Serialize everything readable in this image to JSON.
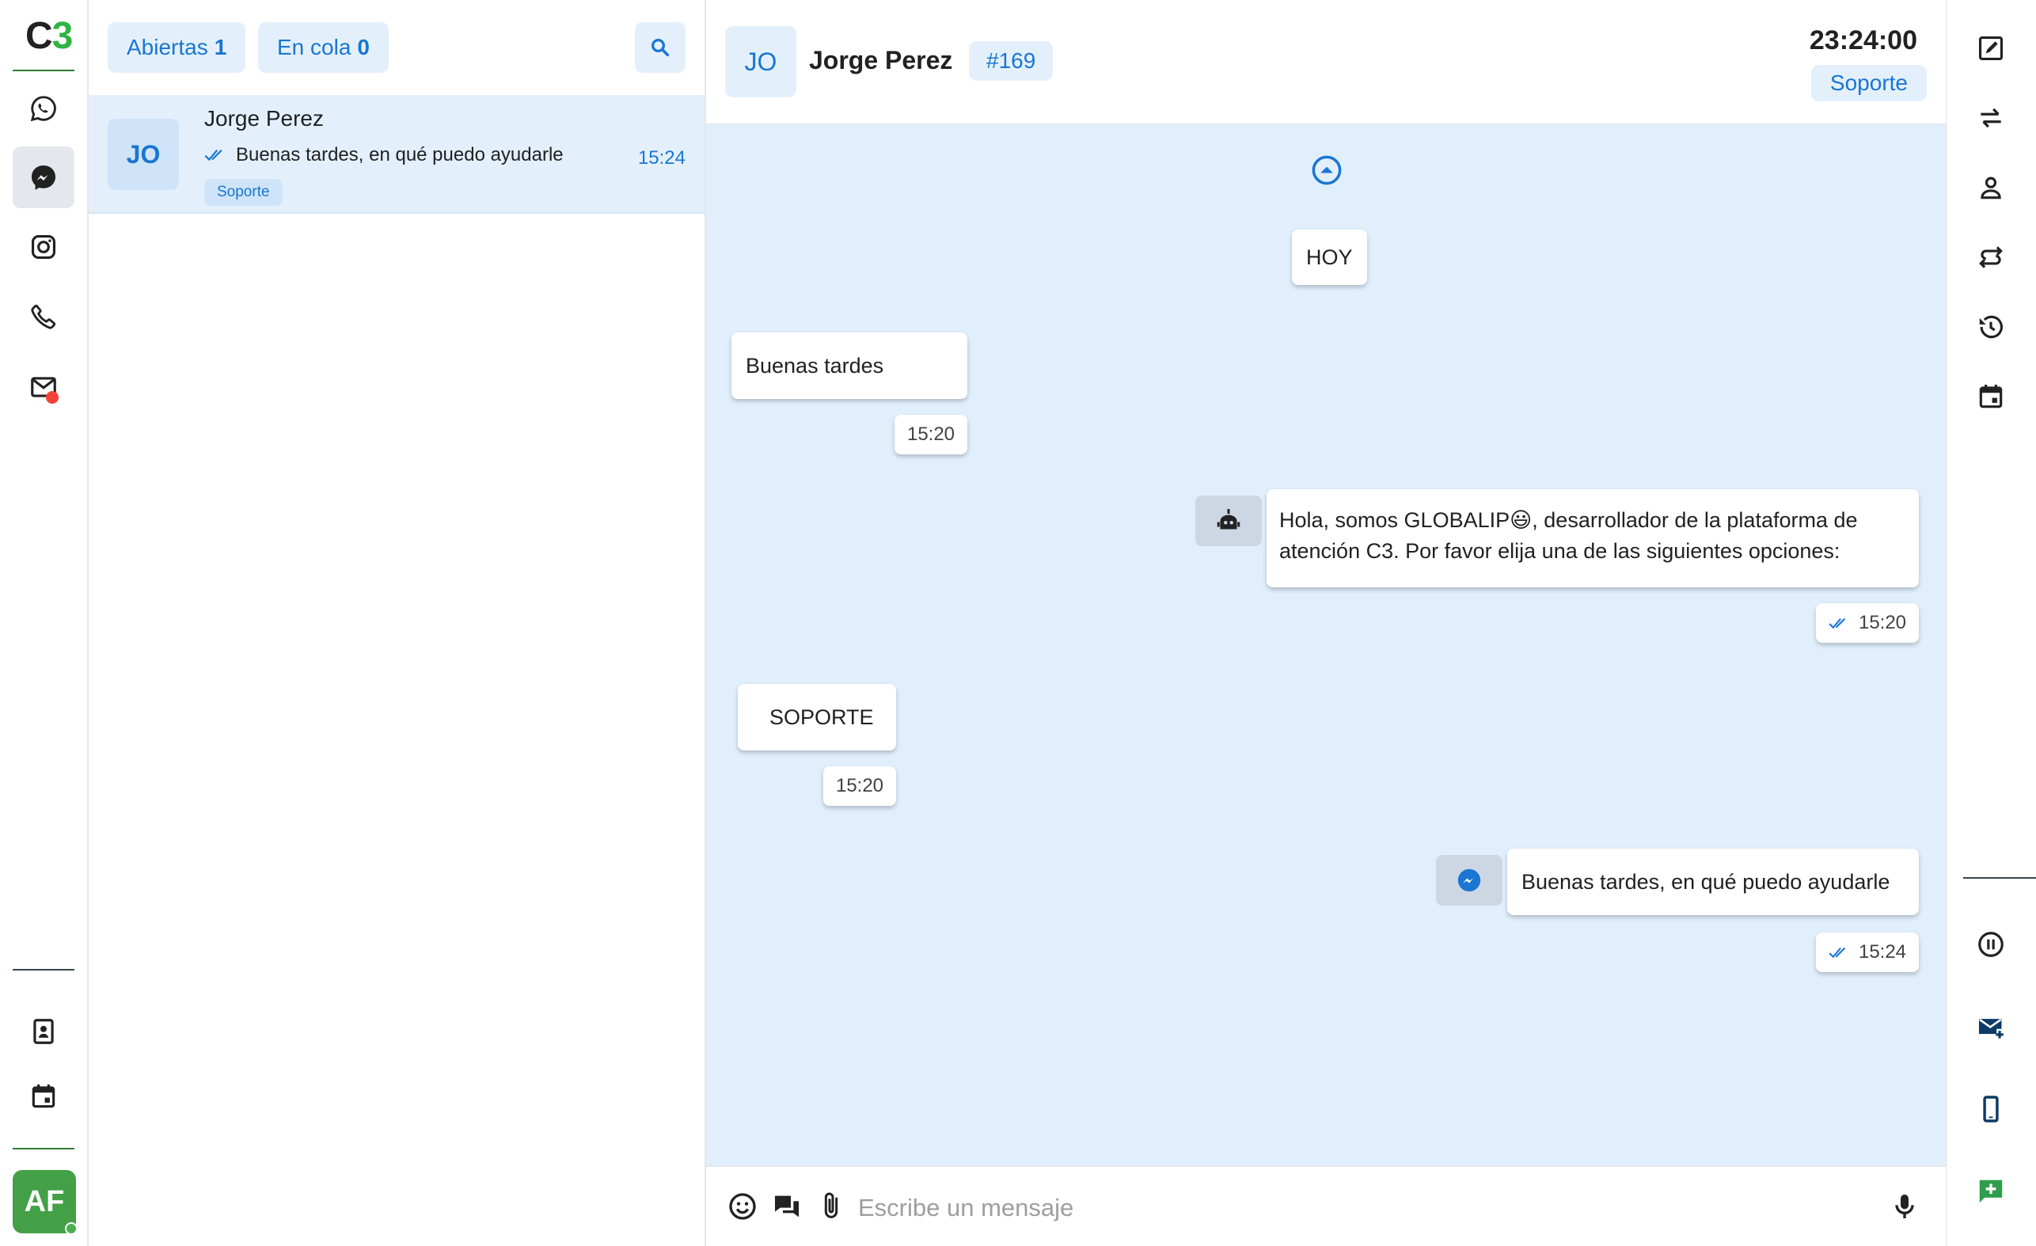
{
  "app": {
    "logo_c": "C",
    "logo_num": "3"
  },
  "rail": {
    "items": [
      {
        "icon": "whatsapp-icon"
      },
      {
        "icon": "messenger-icon",
        "active": true
      },
      {
        "icon": "instagram-icon"
      },
      {
        "icon": "phone-icon"
      },
      {
        "icon": "email-icon",
        "notification": true
      }
    ],
    "bottom_items": [
      {
        "icon": "contacts-icon"
      },
      {
        "icon": "calendar-icon"
      }
    ],
    "user_initials": "AF",
    "user_status": "online"
  },
  "list": {
    "open_label": "Abiertas",
    "open_count": "1",
    "queue_label": "En cola",
    "queue_count": "0",
    "conversations": [
      {
        "initials": "JO",
        "name": "Jorge Perez",
        "last_message": "Buenas tardes, en qué puedo ayudarle",
        "time": "15:24",
        "tag": "Soporte"
      }
    ]
  },
  "chat": {
    "initials": "JO",
    "name": "Jorge Perez",
    "ticket": "#169",
    "clock": "23:24:00",
    "queue": "Soporte",
    "day_separator": "HOY",
    "messages": [
      {
        "text": "Buenas tardes",
        "time": "15:20",
        "direction": "incoming"
      },
      {
        "text_before": "Hola, somos GLOBALIP",
        "emoji": "😃",
        "text_after": ", desarrollador de la plataforma de",
        "text_line2": "atención C3. Por favor elija una de las siguientes opciones:",
        "time": "15:20",
        "direction": "outgoing",
        "sender_icon": "robot-icon",
        "read": true
      },
      {
        "text": "SOPORTE",
        "time": "15:20",
        "direction": "incoming"
      },
      {
        "text": "Buenas tardes, en qué puedo ayudarle",
        "time": "15:24",
        "direction": "outgoing",
        "sender_icon": "messenger-icon",
        "read": true
      }
    ],
    "composer_placeholder": "Escribe un mensaje"
  },
  "colors": {
    "accent": "#1976d2",
    "chat_bg": "#e1effc",
    "brand_green": "#2fb344",
    "notify_red": "#f44336"
  },
  "tools": [
    "edit-icon",
    "transfer-icon",
    "person-icon",
    "swap-icon",
    "history-icon",
    "calendar-icon",
    "pause-icon",
    "new-email-icon",
    "mobile-icon",
    "add-chat-icon"
  ]
}
